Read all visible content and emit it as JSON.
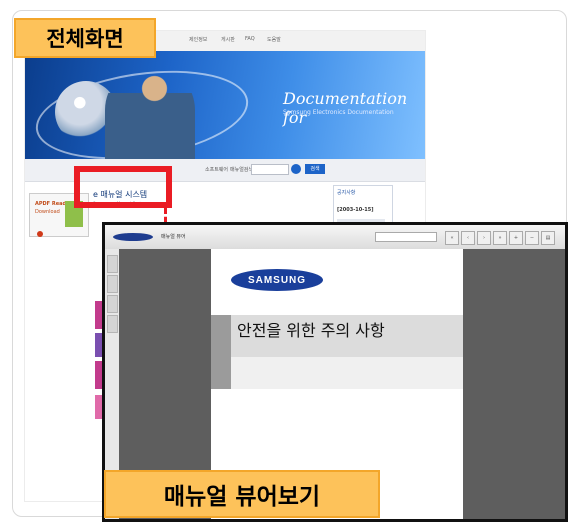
{
  "labels": {
    "full_screen": "전체화면",
    "manual_viewer": "매뉴얼 뷰어보기"
  },
  "site": {
    "nav": [
      "제인정보",
      "게시판",
      "FAQ",
      "도움말"
    ],
    "hero_title": "Documentation for",
    "hero_subtitle": "Samsung Electronics Documentation",
    "search_label": "소프트웨어",
    "search_label2": "매뉴얼검색",
    "search_button": "검색",
    "left_banner_line1": "APDF Reader",
    "left_banner_line2": "Download",
    "manual_link_title": "e 매뉴얼 시스템",
    "manual_link_sub": "Samsung e-Manual System",
    "notice_title": "공지사항",
    "notice_date": "[2003-10-15]"
  },
  "viewer": {
    "toolbar_text": "매뉴얼 뷰어",
    "samsung_logo": "SAMSUNG",
    "page_title": "안전을 위한 주의 사항"
  },
  "colors": {
    "label_fill": "#fdc25a",
    "highlight_red": "#ea1c24",
    "samsung_blue": "#1a3f9b",
    "hero_blue": "#1d64c8"
  }
}
